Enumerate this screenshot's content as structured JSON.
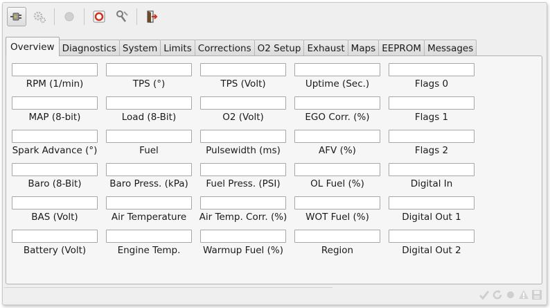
{
  "toolbar": {
    "buttons": [
      {
        "icon": "connect-icon",
        "active": true
      },
      {
        "icon": "gears-icon",
        "active": false
      },
      {
        "icon": "record-icon",
        "active": false
      },
      {
        "icon": "lifebuoy-icon",
        "active": false
      },
      {
        "icon": "wrench-key-icon",
        "active": false
      },
      {
        "icon": "exit-door-icon",
        "active": false
      }
    ]
  },
  "tabs": [
    "Overview",
    "Diagnostics",
    "System",
    "Limits",
    "Corrections",
    "O2 Setup",
    "Exhaust",
    "Maps",
    "EEPROM",
    "Messages"
  ],
  "selected_tab": "Overview",
  "fields": [
    [
      "RPM (1/min)",
      "TPS (°)",
      "TPS (Volt)",
      "Uptime (Sec.)",
      "Flags 0"
    ],
    [
      "MAP (8-bit)",
      "Load (8-Bit)",
      "O2 (Volt)",
      "EGO Corr. (%)",
      "Flags 1"
    ],
    [
      "Spark Advance (°)",
      "Fuel",
      "Pulsewidth (ms)",
      "AFV (%)",
      "Flags 2"
    ],
    [
      "Baro (8-Bit)",
      "Baro Press. (kPa)",
      "Fuel Press. (PSI)",
      "OL Fuel (%)",
      "Digital In"
    ],
    [
      "BAS (Volt)",
      "Air Temperature",
      "Air Temp. Corr. (%)",
      "WOT Fuel (%)",
      "Digital Out 1"
    ],
    [
      "Battery (Volt)",
      "Engine Temp.",
      "Warmup Fuel (%)",
      "Region",
      "Digital Out 2"
    ]
  ],
  "status_icons": [
    "check-icon",
    "refresh-icon",
    "record-dot-icon",
    "warning-icon",
    "save-icon"
  ],
  "colors": {
    "accent_red": "#d03020",
    "window_bg": "#efefef",
    "panel_bg": "#f6f6f6"
  }
}
